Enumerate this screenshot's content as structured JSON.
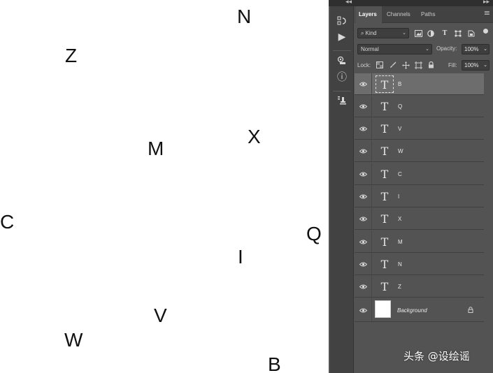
{
  "canvas": {
    "letters": [
      {
        "id": "N",
        "text": "N"
      },
      {
        "id": "Z",
        "text": "Z"
      },
      {
        "id": "M",
        "text": "M"
      },
      {
        "id": "X",
        "text": "X"
      },
      {
        "id": "C",
        "text": "C"
      },
      {
        "id": "Q",
        "text": "Q"
      },
      {
        "id": "I",
        "text": "I"
      },
      {
        "id": "V",
        "text": "V"
      },
      {
        "id": "W",
        "text": "W"
      },
      {
        "id": "B",
        "text": "B"
      }
    ]
  },
  "panel": {
    "collapse_arrows": "◂◂",
    "expand_arrows": "▸▸",
    "tabs": [
      {
        "label": "Layers",
        "active": true
      },
      {
        "label": "Channels",
        "active": false
      },
      {
        "label": "Paths",
        "active": false
      }
    ],
    "menu_icon": "≡",
    "filter": {
      "label": "Kind",
      "search_icon": "⌕",
      "chevron": "⌄"
    },
    "blend_mode": "Normal",
    "opacity_label": "Opacity:",
    "opacity_value": "100%",
    "lock_label": "Lock:",
    "fill_label": "Fill:",
    "fill_value": "100%",
    "chevron": "⌄"
  },
  "toolbar": {
    "icons": [
      {
        "name": "history-icon",
        "glyph": "8⃣"
      },
      {
        "name": "actions-play-icon",
        "glyph": "▶"
      },
      {
        "name": "properties-icon",
        "glyph": "⚙"
      },
      {
        "name": "info-icon",
        "glyph": "ⓘ"
      },
      {
        "name": "clone-source-icon",
        "glyph": "⛉"
      }
    ]
  },
  "layers": [
    {
      "name": "B",
      "selected": true
    },
    {
      "name": "Q",
      "selected": false
    },
    {
      "name": "V",
      "selected": false
    },
    {
      "name": "W",
      "selected": false
    },
    {
      "name": "C",
      "selected": false
    },
    {
      "name": "I",
      "selected": false
    },
    {
      "name": "X",
      "selected": false
    },
    {
      "name": "M",
      "selected": false
    },
    {
      "name": "N",
      "selected": false
    },
    {
      "name": "Z",
      "selected": false
    }
  ],
  "background_layer": {
    "name": "Background"
  },
  "layer_thumb_glyph": "T",
  "watermark": "头条 @设绘谣",
  "colors": {
    "panel_bg": "#535353",
    "dark_bg": "#424242",
    "selected_row": "#6d6d6d",
    "canvas": "#ffffff"
  }
}
